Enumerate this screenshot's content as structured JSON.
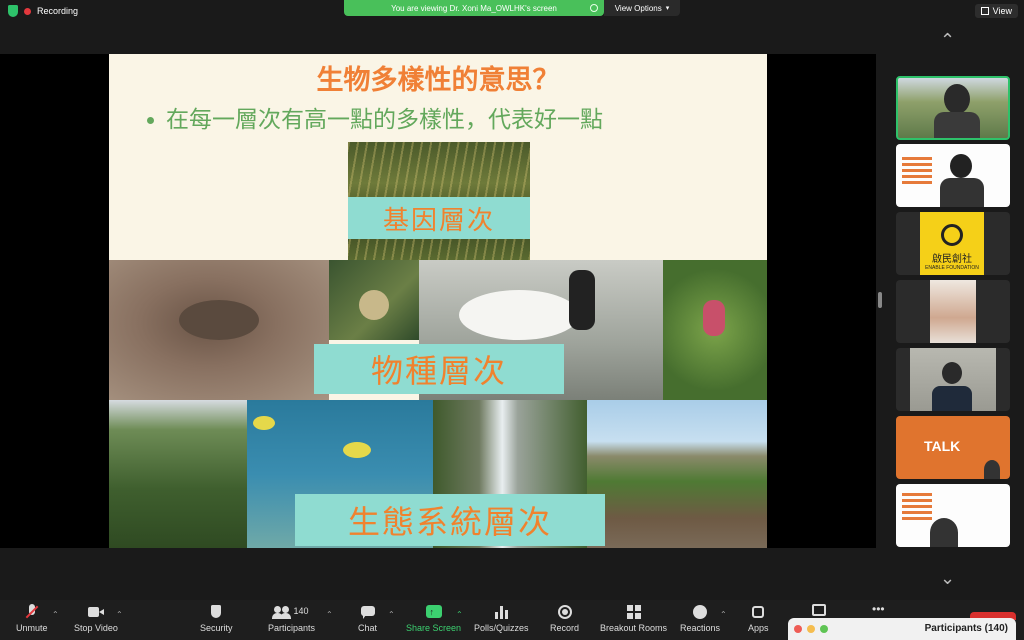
{
  "app": {
    "recording_label": "Recording",
    "viewing_banner": "You are viewing Dr. Xoni Ma_OWLHK's screen",
    "view_options_label": "View Options",
    "view_button_label": "View"
  },
  "slide": {
    "title": "生物多樣性的意思？",
    "bullet": "在每一層次有高一點的多樣性，代表好一點",
    "labels": {
      "genetic": "基因層次",
      "species": "物種層次",
      "ecosystem": "生態系統層次"
    }
  },
  "sidebar": {
    "tiles": [
      {
        "name": "participant-tile-1"
      },
      {
        "name": "participant-tile-2"
      },
      {
        "name": "participant-tile-3",
        "text": "啟民創社",
        "subtext": "ENABLE FOUNDATION"
      },
      {
        "name": "participant-tile-4"
      },
      {
        "name": "participant-tile-5"
      },
      {
        "name": "participant-tile-6",
        "text": "TALK"
      },
      {
        "name": "participant-tile-7"
      }
    ]
  },
  "toolbar": {
    "unmute": "Unmute",
    "stop_video": "Stop Video",
    "security": "Security",
    "participants": "Participants",
    "participants_count": "140",
    "chat": "Chat",
    "share_screen": "Share Screen",
    "polls": "Polls/Quizzes",
    "record": "Record",
    "breakout": "Breakout Rooms",
    "reactions": "Reactions",
    "apps": "Apps"
  },
  "participants_panel": {
    "title": "Participants (140)"
  },
  "colors": {
    "accent_green": "#2ec26a",
    "slide_title_orange": "#f08036",
    "slide_bullet_green": "#63a85c",
    "label_teal": "#8fdcd1",
    "recording_red": "#e3383d"
  }
}
